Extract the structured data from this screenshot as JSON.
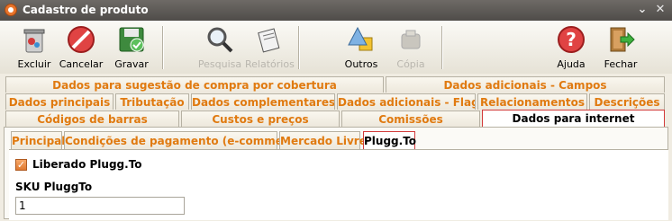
{
  "window": {
    "title": "Cadastro de produto",
    "minimize_glyph": "⌄",
    "close_glyph": "✕"
  },
  "toolbar": {
    "excluir": "Excluir",
    "cancelar": "Cancelar",
    "gravar": "Gravar",
    "pesquisa": "Pesquisa",
    "relatorios": "Relatórios",
    "outros": "Outros",
    "copia": "Cópia",
    "ajuda": "Ajuda",
    "fechar": "Fechar"
  },
  "tabs": {
    "row1": [
      "Dados para sugestão de compra por cobertura",
      "Dados adicionais - Campos"
    ],
    "row2": [
      "Dados principais",
      "Tributação",
      "Dados complementares",
      "Dados adicionais - Flags",
      "Relacionamentos",
      "Descrições"
    ],
    "row3": [
      "Códigos de barras",
      "Custos e preços",
      "Comissões",
      "Dados para internet"
    ]
  },
  "subtabs": [
    "Principal",
    "Condições de pagamento (e-commerce)",
    "Mercado Livre",
    "Plugg.To"
  ],
  "form": {
    "checkbox_label": "Liberado Plugg.To",
    "checkbox_checked": true,
    "checkbox_glyph": "✓",
    "sku_label": "SKU PluggTo",
    "sku_value": "1"
  },
  "colors": {
    "accent": "#e07a10",
    "active_border": "#d23a3a"
  }
}
